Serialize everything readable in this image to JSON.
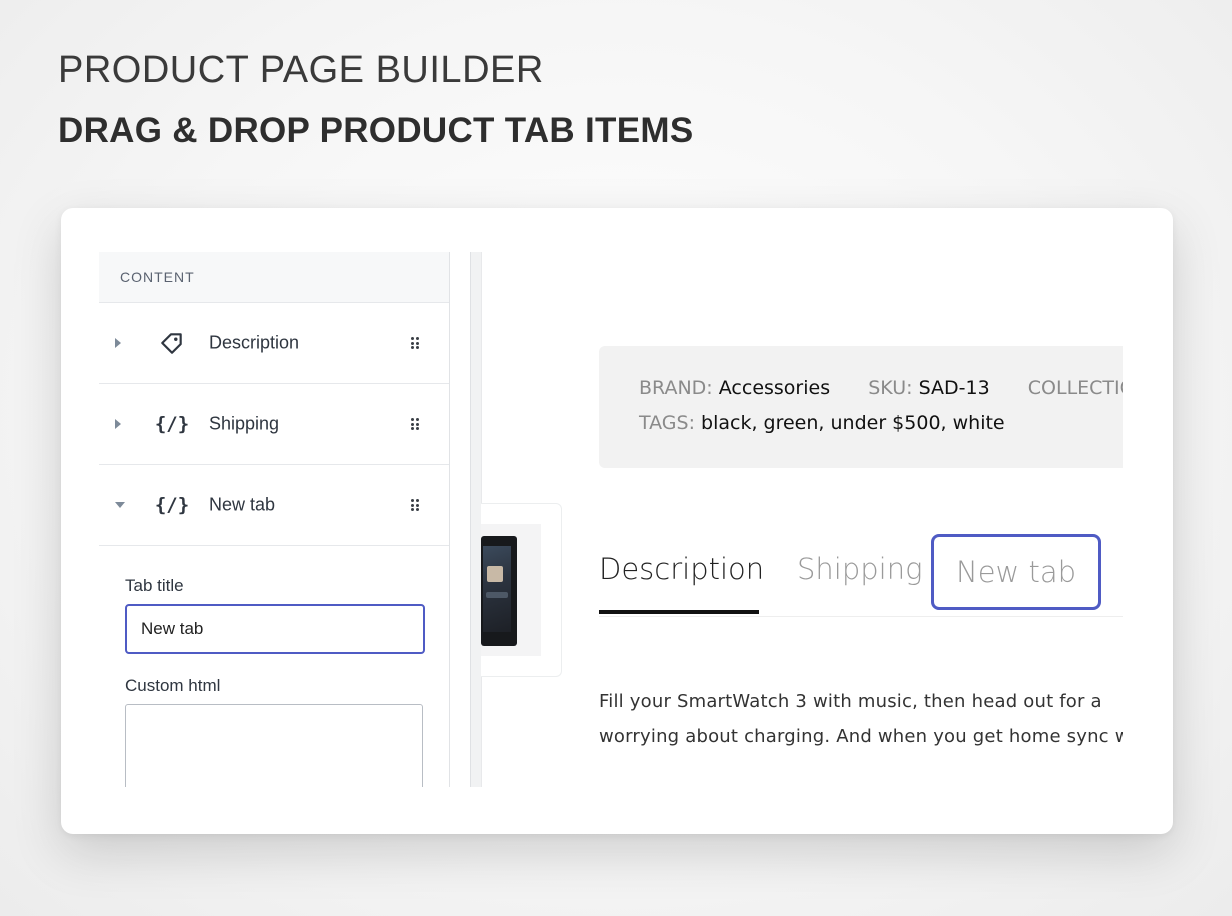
{
  "hero": {
    "title": "PRODUCT PAGE BUILDER",
    "subtitle": "DRAG & DROP PRODUCT TAB ITEMS"
  },
  "sidebar": {
    "header": "CONTENT",
    "items": [
      {
        "label": "Description",
        "icon": "tag-icon",
        "expanded": false
      },
      {
        "label": "Shipping",
        "icon": "code-icon",
        "icon_glyph": "{/}",
        "expanded": false
      },
      {
        "label": "New tab",
        "icon": "code-icon",
        "icon_glyph": "{/}",
        "expanded": true
      }
    ],
    "editor": {
      "tab_title_label": "Tab title",
      "tab_title_value": "New tab",
      "custom_html_label": "Custom html",
      "custom_html_value": ""
    }
  },
  "product": {
    "brand_key": "BRAND:",
    "brand_value": "Accessories",
    "sku_key": "SKU:",
    "sku_value": "SAD-13",
    "collection_key": "COLLECTIO",
    "tags_key": "TAGS:",
    "tags_value": "black, green, under $500, white",
    "tabs": [
      "Description",
      "Shipping",
      "New tab"
    ],
    "active_tab": "Description",
    "description_lines": [
      "Fill your SmartWatch 3 with music, then head out for a",
      "worrying about charging. And when you get home sync witl"
    ]
  },
  "colors": {
    "accent": "#4f5bc4",
    "text_dark": "#2f3640",
    "muted": "#9a9a9a",
    "meta_bg": "#f2f2f2"
  }
}
